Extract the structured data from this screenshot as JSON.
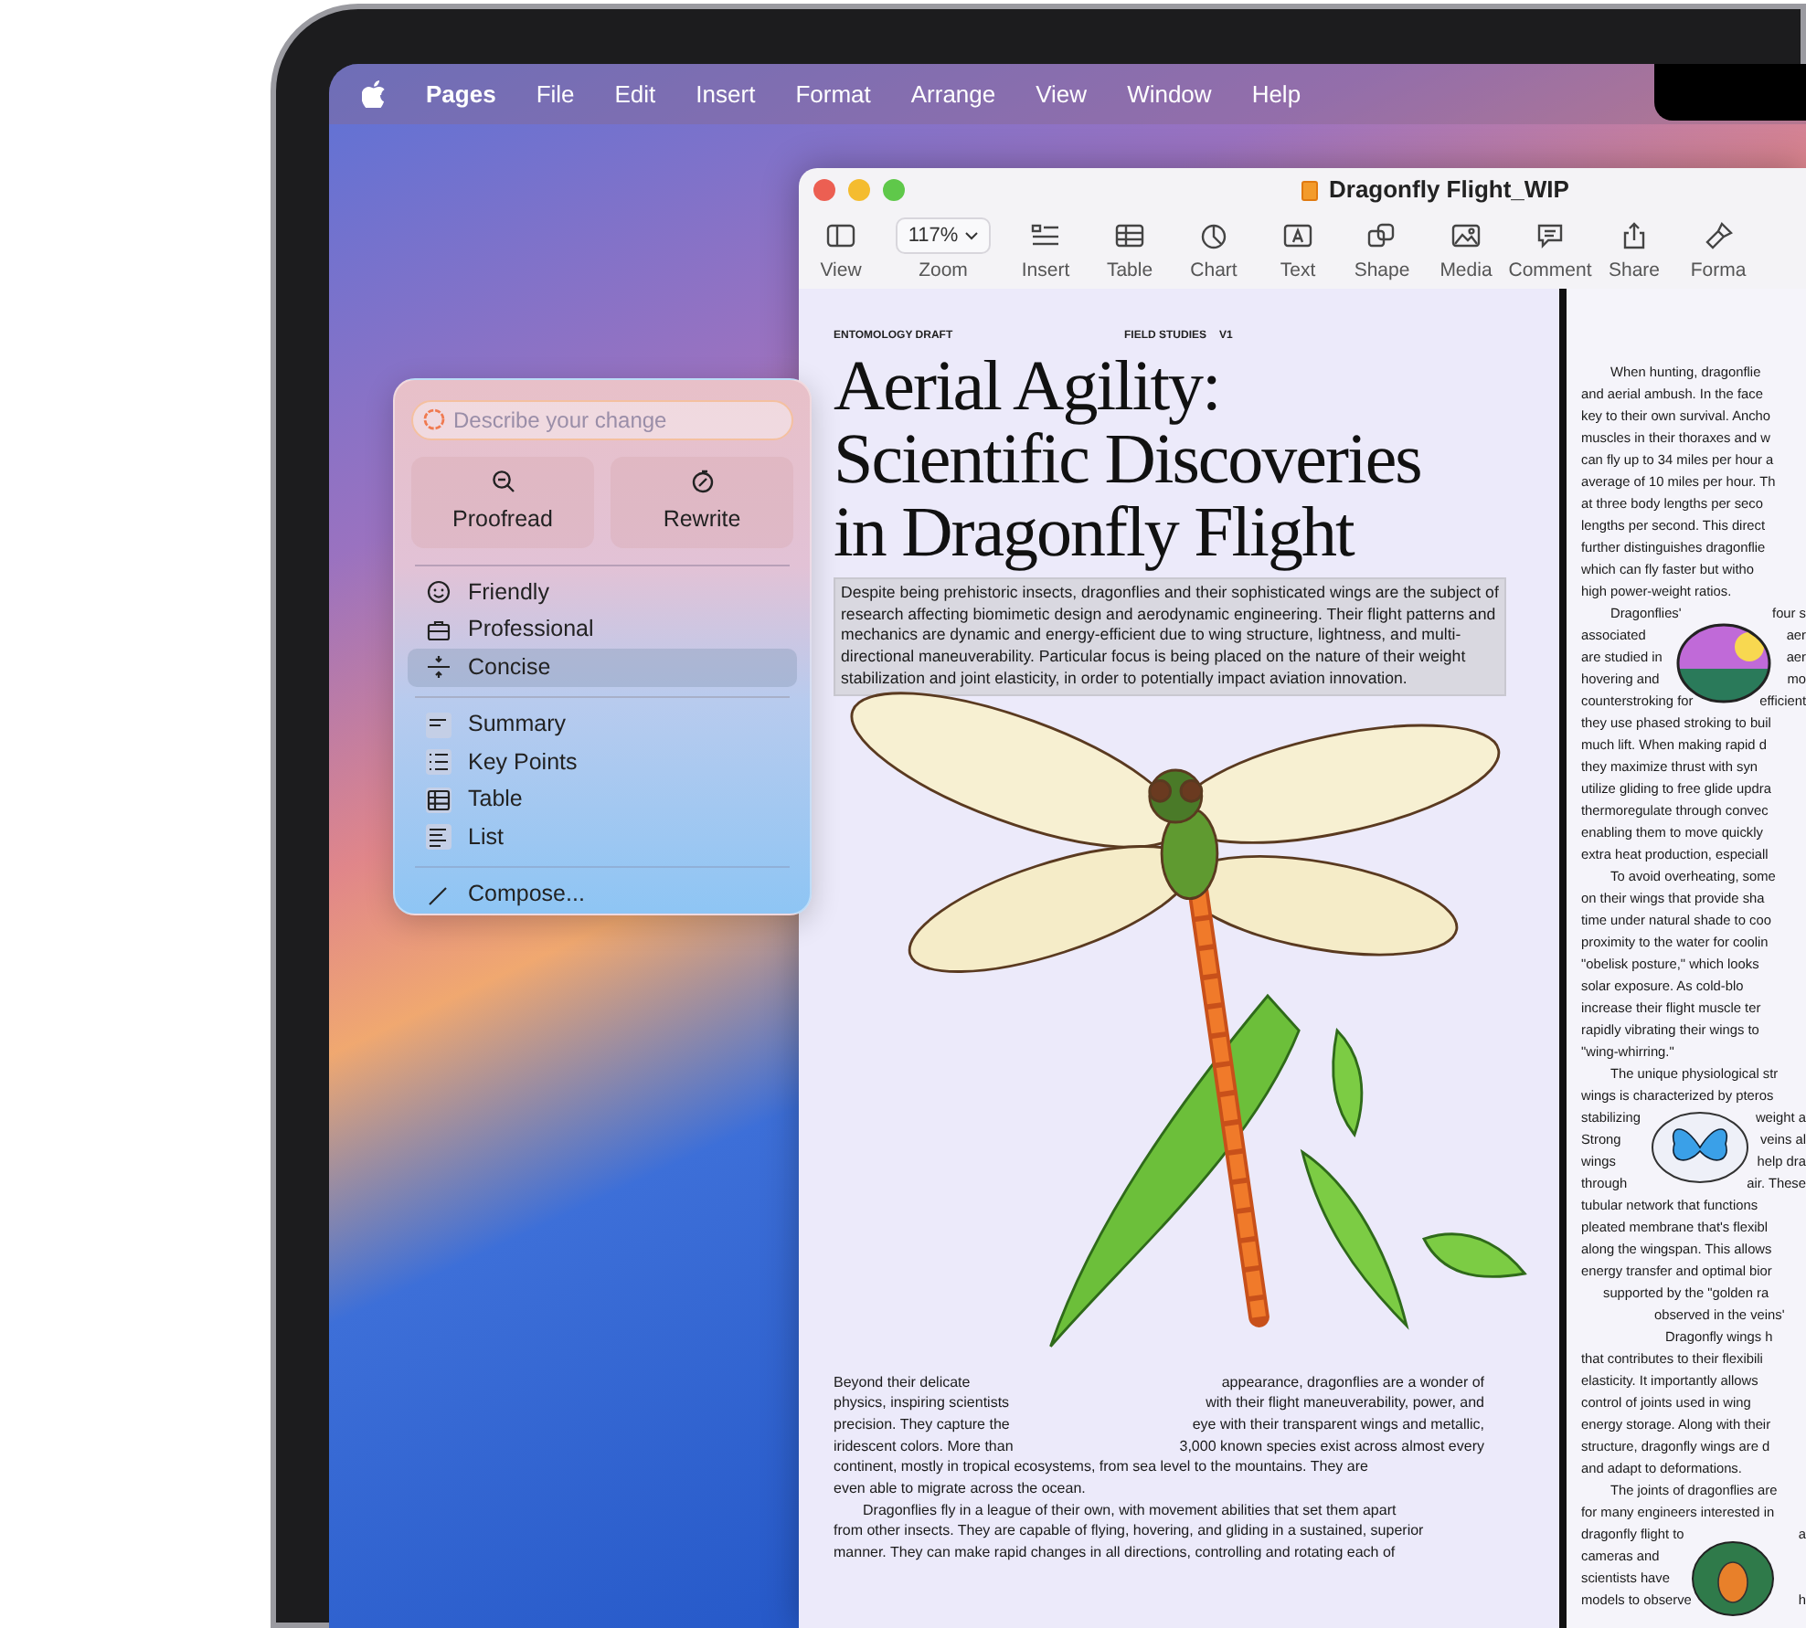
{
  "menu_bar": {
    "items": [
      {
        "label": "Pages",
        "kind": "app"
      },
      {
        "label": "File",
        "kind": "menu"
      },
      {
        "label": "Edit",
        "kind": "menu"
      },
      {
        "label": "Insert",
        "kind": "menu"
      },
      {
        "label": "Format",
        "kind": "menu"
      },
      {
        "label": "Arrange",
        "kind": "menu"
      },
      {
        "label": "View",
        "kind": "menu"
      },
      {
        "label": "Window",
        "kind": "menu"
      },
      {
        "label": "Help",
        "kind": "menu"
      }
    ]
  },
  "window": {
    "title": "Dragonfly Flight_WIP",
    "toolbar": [
      {
        "label": "View",
        "kind": "icon"
      },
      {
        "label": "Zoom",
        "kind": "dropdown",
        "value": "117%"
      },
      {
        "label": "Insert",
        "kind": "icon"
      },
      {
        "label": "Table",
        "kind": "icon"
      },
      {
        "label": "Chart",
        "kind": "icon"
      },
      {
        "label": "Text",
        "kind": "icon"
      },
      {
        "label": "Shape",
        "kind": "icon"
      },
      {
        "label": "Media",
        "kind": "icon"
      },
      {
        "label": "Comment",
        "kind": "icon"
      },
      {
        "label": "Share",
        "kind": "icon"
      },
      {
        "label": "Forma",
        "kind": "icon"
      }
    ]
  },
  "document": {
    "header": {
      "left": "ENTOMOLOGY DRAFT",
      "center": "FIELD STUDIES",
      "right": "V1"
    },
    "title": "Aerial Agility: Scientific Discoveries in Dragonfly Flight",
    "intro": {
      "text": "Despite being prehistoric insects, dragonflies and their sophisticated wings are the subject of research affecting biomimetic design and aerodynamic engineering. Their flight patterns and mechanics are dynamic and energy-efficient due to wing structure, lightness, and multi-directional maneuverability. Particular focus is being placed on the nature of their weight stabilization and joint elasticity, in order to potentially impact aviation innovation.",
      "selected": true
    },
    "body_left": [
      {
        "kind": "plain",
        "segments": [
          "Beyond their delicate",
          "appearance, dragonflies are a wonder of"
        ]
      },
      {
        "kind": "plain",
        "segments": [
          "physics, inspiring scientists",
          "with their flight maneuverability, power, and"
        ]
      },
      {
        "kind": "plain",
        "segments": [
          "precision. They capture the",
          "eye with their transparent wings and metallic,"
        ]
      },
      {
        "kind": "plain",
        "segments": [
          "iridescent colors. More than",
          "3,000 known species exist across almost every"
        ]
      },
      {
        "kind": "plain",
        "segments": [
          "continent, mostly in tropical ecosystems, from sea level to the mountains. They are"
        ]
      },
      {
        "kind": "plain",
        "segments": [
          "even able to migrate across the ocean."
        ]
      },
      {
        "kind": "first",
        "segments": [
          "Dragonflies fly in a league of their own, with movement abilities that set them apart"
        ]
      },
      {
        "kind": "plain",
        "segments": [
          "from other insects. They are capable of flying, hovering, and gliding in a sustained, superior"
        ]
      },
      {
        "kind": "plain",
        "segments": [
          "manner. They can make rapid changes in all directions, controlling and rotating each of"
        ]
      }
    ],
    "body_right": [
      {
        "kind": "first",
        "segments": [
          "When hunting, dragonflie"
        ]
      },
      {
        "kind": "plain",
        "segments": [
          "and aerial ambush. In the face"
        ]
      },
      {
        "kind": "plain",
        "segments": [
          "key to their own survival. Ancho"
        ]
      },
      {
        "kind": "plain",
        "segments": [
          "muscles in their thoraxes and w"
        ]
      },
      {
        "kind": "plain",
        "segments": [
          "can fly up to 34 miles per hour a"
        ]
      },
      {
        "kind": "plain",
        "segments": [
          "average of 10 miles per hour. Th"
        ]
      },
      {
        "kind": "plain",
        "segments": [
          "at three body lengths per seco"
        ]
      },
      {
        "kind": "plain",
        "segments": [
          "lengths per second. This direct"
        ]
      },
      {
        "kind": "plain",
        "segments": [
          "further distinguishes dragonflie"
        ]
      },
      {
        "kind": "plain",
        "segments": [
          "which can fly faster but witho"
        ]
      },
      {
        "kind": "plain",
        "segments": [
          "high power-weight ratios."
        ]
      },
      {
        "kind": "first",
        "segments": [
          "Dragonflies'",
          "four s"
        ]
      },
      {
        "kind": "plain",
        "segments": [
          "associated",
          "aer"
        ]
      },
      {
        "kind": "plain",
        "segments": [
          "are studied in",
          "aer"
        ]
      },
      {
        "kind": "plain",
        "segments": [
          "hovering and",
          "mo"
        ]
      },
      {
        "kind": "plain",
        "segments": [
          "counterstroking for",
          "efficient"
        ]
      },
      {
        "kind": "plain",
        "segments": [
          "they use phased stroking to buil"
        ]
      },
      {
        "kind": "plain",
        "segments": [
          "much lift. When making rapid d"
        ]
      },
      {
        "kind": "plain",
        "segments": [
          "they maximize thrust with syn"
        ]
      },
      {
        "kind": "plain",
        "segments": [
          "utilize gliding to free glide updra"
        ]
      },
      {
        "kind": "plain",
        "segments": [
          "thermoregulate through convec"
        ]
      },
      {
        "kind": "plain",
        "segments": [
          "enabling them to move quickly"
        ]
      },
      {
        "kind": "plain",
        "segments": [
          "extra heat production, especiall"
        ]
      },
      {
        "kind": "first",
        "segments": [
          "To avoid overheating, some"
        ]
      },
      {
        "kind": "plain",
        "segments": [
          "on their wings that provide sha"
        ]
      },
      {
        "kind": "plain",
        "segments": [
          "time under natural shade to coo"
        ]
      },
      {
        "kind": "plain",
        "segments": [
          "proximity to the water for coolin"
        ]
      },
      {
        "kind": "plain",
        "segments": [
          "\"obelisk posture,\" which looks"
        ]
      },
      {
        "kind": "plain",
        "segments": [
          "solar exposure. As cold-blo"
        ]
      },
      {
        "kind": "plain",
        "segments": [
          "increase their flight muscle ter"
        ]
      },
      {
        "kind": "plain",
        "segments": [
          "rapidly vibrating their wings to"
        ]
      },
      {
        "kind": "plain",
        "segments": [
          "\"wing-whirring.\""
        ]
      },
      {
        "kind": "first",
        "segments": [
          "The unique physiological str"
        ]
      },
      {
        "kind": "plain",
        "segments": [
          "wings is characterized by pteros"
        ]
      },
      {
        "kind": "plain",
        "segments": [
          "stabilizing",
          "weight a"
        ]
      },
      {
        "kind": "plain",
        "segments": [
          "Strong",
          "veins al"
        ]
      },
      {
        "kind": "plain",
        "segments": [
          "wings",
          "help dra"
        ]
      },
      {
        "kind": "plain",
        "segments": [
          "through",
          "air. These"
        ]
      },
      {
        "kind": "plain",
        "segments": [
          "tubular network that functions"
        ]
      },
      {
        "kind": "plain",
        "segments": [
          "pleated membrane that's flexibl"
        ]
      },
      {
        "kind": "plain",
        "segments": [
          "along the wingspan. This allows"
        ]
      },
      {
        "kind": "plain",
        "segments": [
          "energy transfer and optimal bior"
        ]
      },
      {
        "kind": "inset",
        "segments": [
          "supported by the \"golden ra"
        ]
      },
      {
        "kind": "deep",
        "segments": [
          "observed in the veins'"
        ]
      },
      {
        "kind": "deeper",
        "segments": [
          "Dragonfly wings h"
        ]
      },
      {
        "kind": "plain",
        "segments": [
          "that contributes to their flexibili"
        ]
      },
      {
        "kind": "plain",
        "segments": [
          "elasticity. It importantly allows"
        ]
      },
      {
        "kind": "plain",
        "segments": [
          "control of joints used in wing"
        ]
      },
      {
        "kind": "plain",
        "segments": [
          "energy storage. Along with their"
        ]
      },
      {
        "kind": "plain",
        "segments": [
          "structure, dragonfly wings are d"
        ]
      },
      {
        "kind": "plain",
        "segments": [
          "and adapt to deformations."
        ]
      },
      {
        "kind": "first",
        "segments": [
          "The joints of dragonflies are"
        ]
      },
      {
        "kind": "plain",
        "segments": [
          "for many engineers interested in"
        ]
      },
      {
        "kind": "plain",
        "segments": [
          "dragonfly flight to",
          "a"
        ]
      },
      {
        "kind": "plain",
        "segments": [
          "cameras and"
        ]
      },
      {
        "kind": "plain",
        "segments": [
          "scientists have"
        ]
      },
      {
        "kind": "plain",
        "segments": [
          "models to observe",
          "h"
        ]
      }
    ]
  },
  "writing_tools": {
    "placeholder": "Describe your change",
    "actions": [
      {
        "label": "Proofread"
      },
      {
        "label": "Rewrite"
      }
    ],
    "tones": [
      {
        "label": "Friendly",
        "selected": false
      },
      {
        "label": "Professional",
        "selected": false
      },
      {
        "label": "Concise",
        "selected": true
      }
    ],
    "formats": [
      {
        "label": "Summary"
      },
      {
        "label": "Key Points"
      },
      {
        "label": "Table"
      },
      {
        "label": "List"
      }
    ],
    "compose": {
      "label": "Compose..."
    }
  }
}
